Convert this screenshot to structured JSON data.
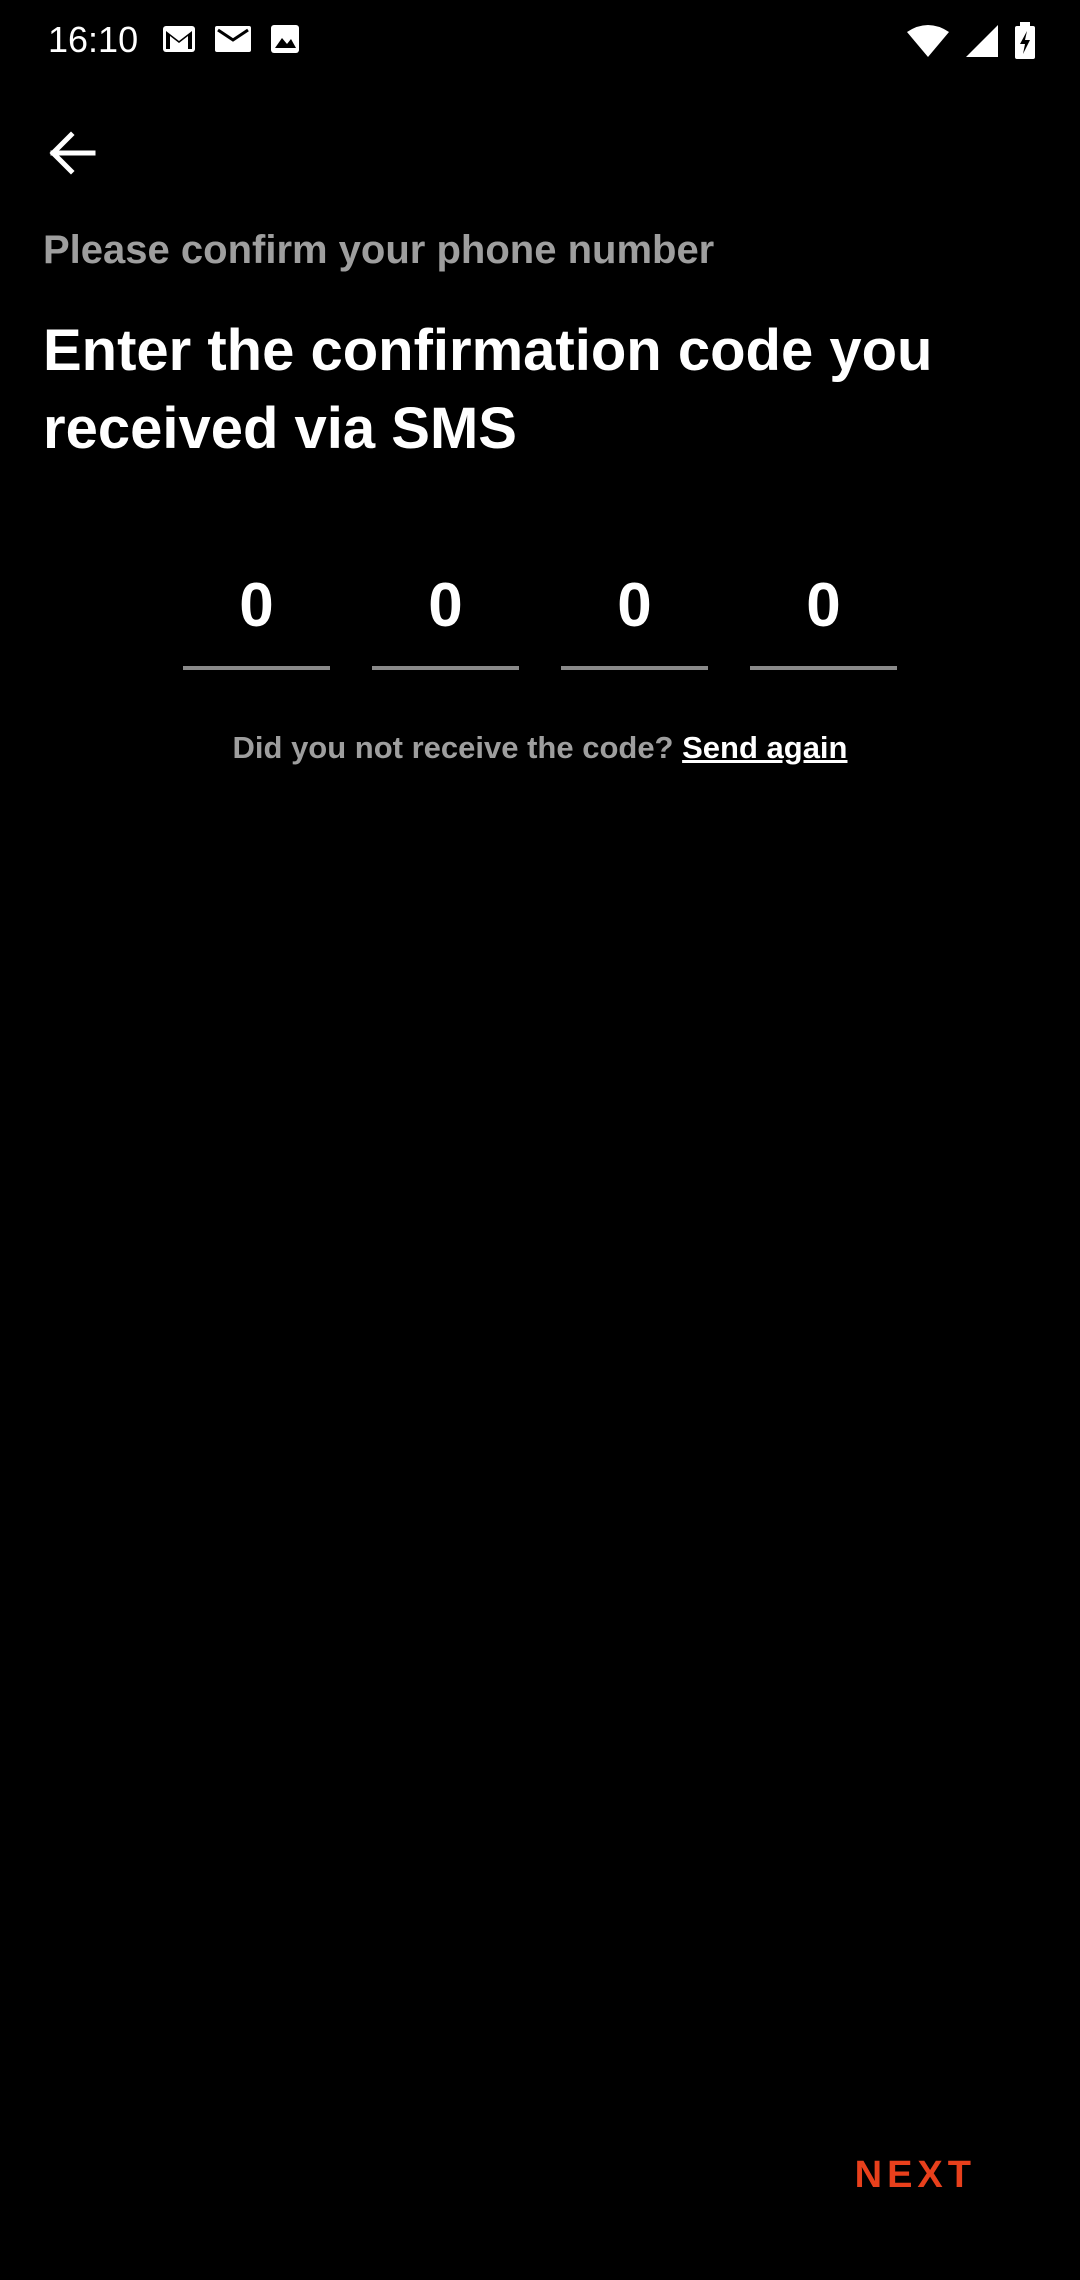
{
  "status_bar": {
    "time": "16:10",
    "left_icons": [
      "gmail-icon",
      "mail-icon",
      "image-icon"
    ],
    "right_icons": [
      "wifi-icon",
      "signal-icon",
      "battery-charging-icon"
    ]
  },
  "header": {
    "back_icon": "arrow-left-icon"
  },
  "content": {
    "subtitle": "Please confirm your phone number",
    "heading": "Enter the confirmation code you received via SMS",
    "code_digits": [
      "0",
      "0",
      "0",
      "0"
    ],
    "resend_prompt": "Did you not receive the code? ",
    "resend_link": "Send again"
  },
  "footer": {
    "next_label": "NEXT"
  },
  "colors": {
    "background": "#000000",
    "accent": "#e8401c",
    "muted_text": "#9e9e9e",
    "underline": "#8a8a8a"
  }
}
